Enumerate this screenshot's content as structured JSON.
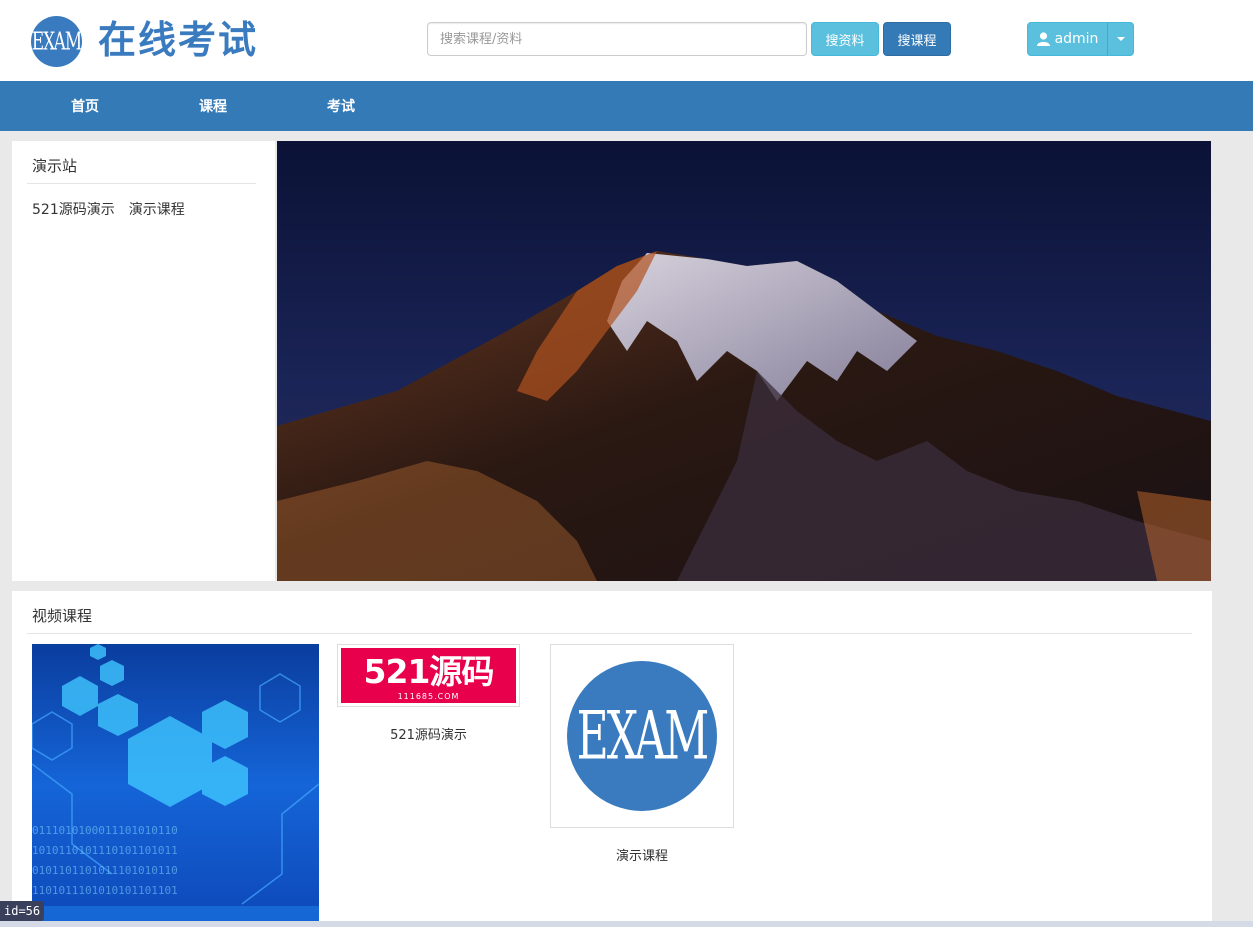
{
  "header": {
    "logo_text": "EXAM",
    "site_title": "在线考试",
    "search_placeholder": "搜索课程/资料",
    "search_materials_label": "搜资料",
    "search_courses_label": "搜课程",
    "user_label": "admin"
  },
  "nav": {
    "items": [
      {
        "label": "首页"
      },
      {
        "label": "课程"
      },
      {
        "label": "考试"
      }
    ]
  },
  "sidebar": {
    "title": "演示站",
    "links": [
      {
        "label": "521源码演示"
      },
      {
        "label": "演示课程"
      }
    ]
  },
  "courses": {
    "title": "视频课程",
    "items": [
      {
        "name": ""
      },
      {
        "name": "521源码演示",
        "thumb_text": "521源码",
        "thumb_subtext": "111685.COM"
      },
      {
        "name": "演示课程",
        "thumb_text": "EXAM"
      }
    ]
  },
  "debug": {
    "label": "id=56"
  },
  "colors": {
    "brand": "#3a7bbf",
    "nav": "#337ab7",
    "info": "#5bc0de",
    "accent_red": "#e8004c"
  },
  "icons": {
    "user": "user-icon",
    "caret": "caret-down-icon"
  }
}
